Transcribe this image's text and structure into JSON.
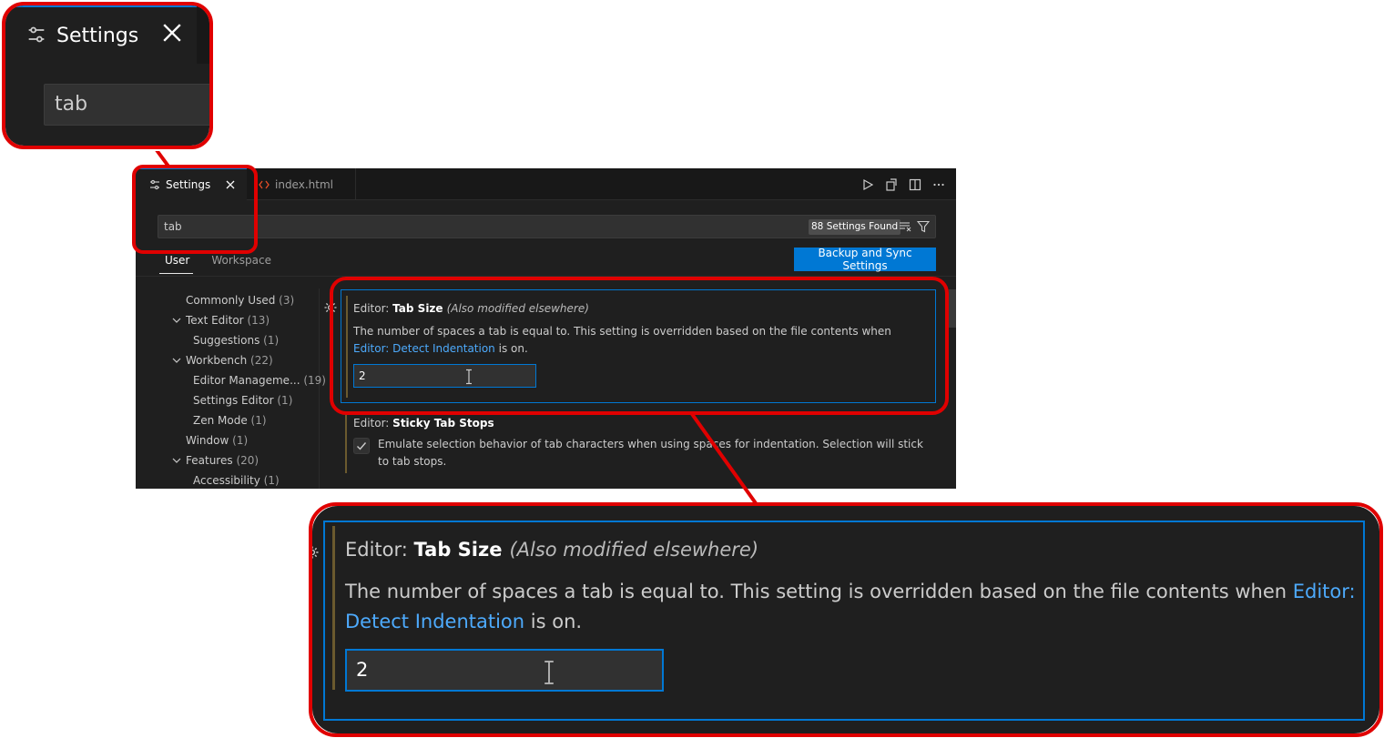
{
  "tabs": [
    {
      "label": "Settings",
      "close": "✕"
    },
    {
      "label": "index.html"
    }
  ],
  "search": {
    "value": "tab",
    "results_badge": "88 Settings Found"
  },
  "scope_tabs": [
    "User",
    "Workspace"
  ],
  "sync_button": "Backup and Sync Settings",
  "toc": [
    {
      "label": "Commonly Used",
      "count": "(3)"
    },
    {
      "label": "Text Editor",
      "count": "(13)"
    },
    {
      "label": "Suggestions",
      "count": "(1)"
    },
    {
      "label": "Workbench",
      "count": "(22)"
    },
    {
      "label": "Editor Manageme...",
      "count": "(19)"
    },
    {
      "label": "Settings Editor",
      "count": "(1)"
    },
    {
      "label": "Zen Mode",
      "count": "(1)"
    },
    {
      "label": "Window",
      "count": "(1)"
    },
    {
      "label": "Features",
      "count": "(20)"
    },
    {
      "label": "Accessibility",
      "count": "(1)"
    }
  ],
  "tab_size_setting": {
    "category": "Editor: ",
    "name": "Tab Size",
    "modified_note": "(Also modified elsewhere)",
    "desc_before": "The number of spaces a tab is equal to. This setting is overridden based on the file contents when ",
    "desc_link": "Editor: Detect Indentation",
    "desc_link_part1": "Editor:",
    "desc_link_part2": "Detect Indentation",
    "desc_after": " is on.",
    "value": "2"
  },
  "sticky_tab_setting": {
    "category": "Editor: ",
    "name": "Sticky Tab Stops",
    "description": "Emulate selection behavior of tab characters when using spaces for indentation. Selection will stick to tab stops.",
    "checked": true
  },
  "colors": {
    "accent": "#0078d4",
    "link": "#4daafc",
    "callout_frame": "#e00000",
    "background": "#1f1f1f"
  },
  "icons": [
    "settings-sliders-icon",
    "close-icon",
    "html-code-icon",
    "run-icon",
    "open-preview-icon",
    "split-editor-icon",
    "more-actions-icon",
    "clear-filter-icon",
    "filter-icon",
    "chevron-down-icon",
    "gear-icon",
    "checkmark-icon",
    "text-cursor-icon"
  ]
}
